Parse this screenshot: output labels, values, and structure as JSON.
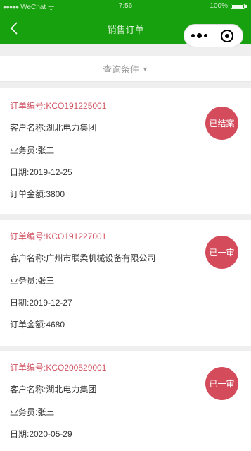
{
  "status_bar": {
    "signal": "●●●●●",
    "carrier": "WeChat",
    "wifi": "ᯤ",
    "time": "7:56",
    "battery": "100%"
  },
  "nav": {
    "back_icon": "chevron-left-icon",
    "title": "销售订单"
  },
  "filter": {
    "label": "查询条件",
    "arrow": "▼"
  },
  "orders": [
    {
      "order_no": "订单编号:KCO191225001",
      "customer": "客户名称:湖北电力集团",
      "salesman": "业务员:张三",
      "date": "日期:2019-12-25",
      "amount": "订单金额:3800",
      "status": "已结案"
    },
    {
      "order_no": "订单编号:KCO191227001",
      "customer": "客户名称:广州市联柔机械设备有限公司",
      "salesman": "业务员:张三",
      "date": "日期:2019-12-27",
      "amount": "订单金额:4680",
      "status": "已一审"
    },
    {
      "order_no": "订单编号:KCO200529001",
      "customer": "客户名称:湖北电力集团",
      "salesman": "业务员:张三",
      "date": "日期:2020-05-29",
      "status": "已一审"
    }
  ],
  "colors": {
    "header_green": "#17a10e",
    "order_no_red": "#d15563",
    "badge_red": "#d44c5c"
  }
}
